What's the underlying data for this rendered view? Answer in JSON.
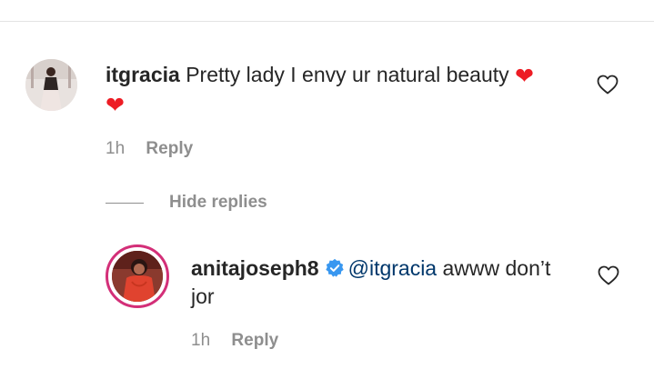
{
  "comment": {
    "username": "itgracia",
    "text": "Pretty lady I envy ur natural beauty",
    "emoji_inline": "❤",
    "emoji_wrapped": "❤",
    "time": "1h",
    "reply_label": "Reply",
    "avatar_icon": "profile-photo-avatar",
    "like_icon": "heart-outline-icon"
  },
  "toggle": {
    "hide_replies_label": "Hide replies"
  },
  "reply": {
    "username": "anitajoseph8",
    "verified_icon": "verified-badge-icon",
    "mention": "@itgracia",
    "text_line1": "awww don’t",
    "text_line2": "jor",
    "time": "1h",
    "reply_label": "Reply",
    "avatar_icon": "profile-photo-avatar-with-story-ring",
    "like_icon": "heart-outline-icon"
  },
  "colors": {
    "text": "#262626",
    "meta": "#8e8e8e",
    "mention": "#00376b",
    "verified": "#3897f0",
    "heart_emoji": "#ed1c24",
    "story_ring": "#d32f78",
    "divider": "#e3e3e3"
  }
}
